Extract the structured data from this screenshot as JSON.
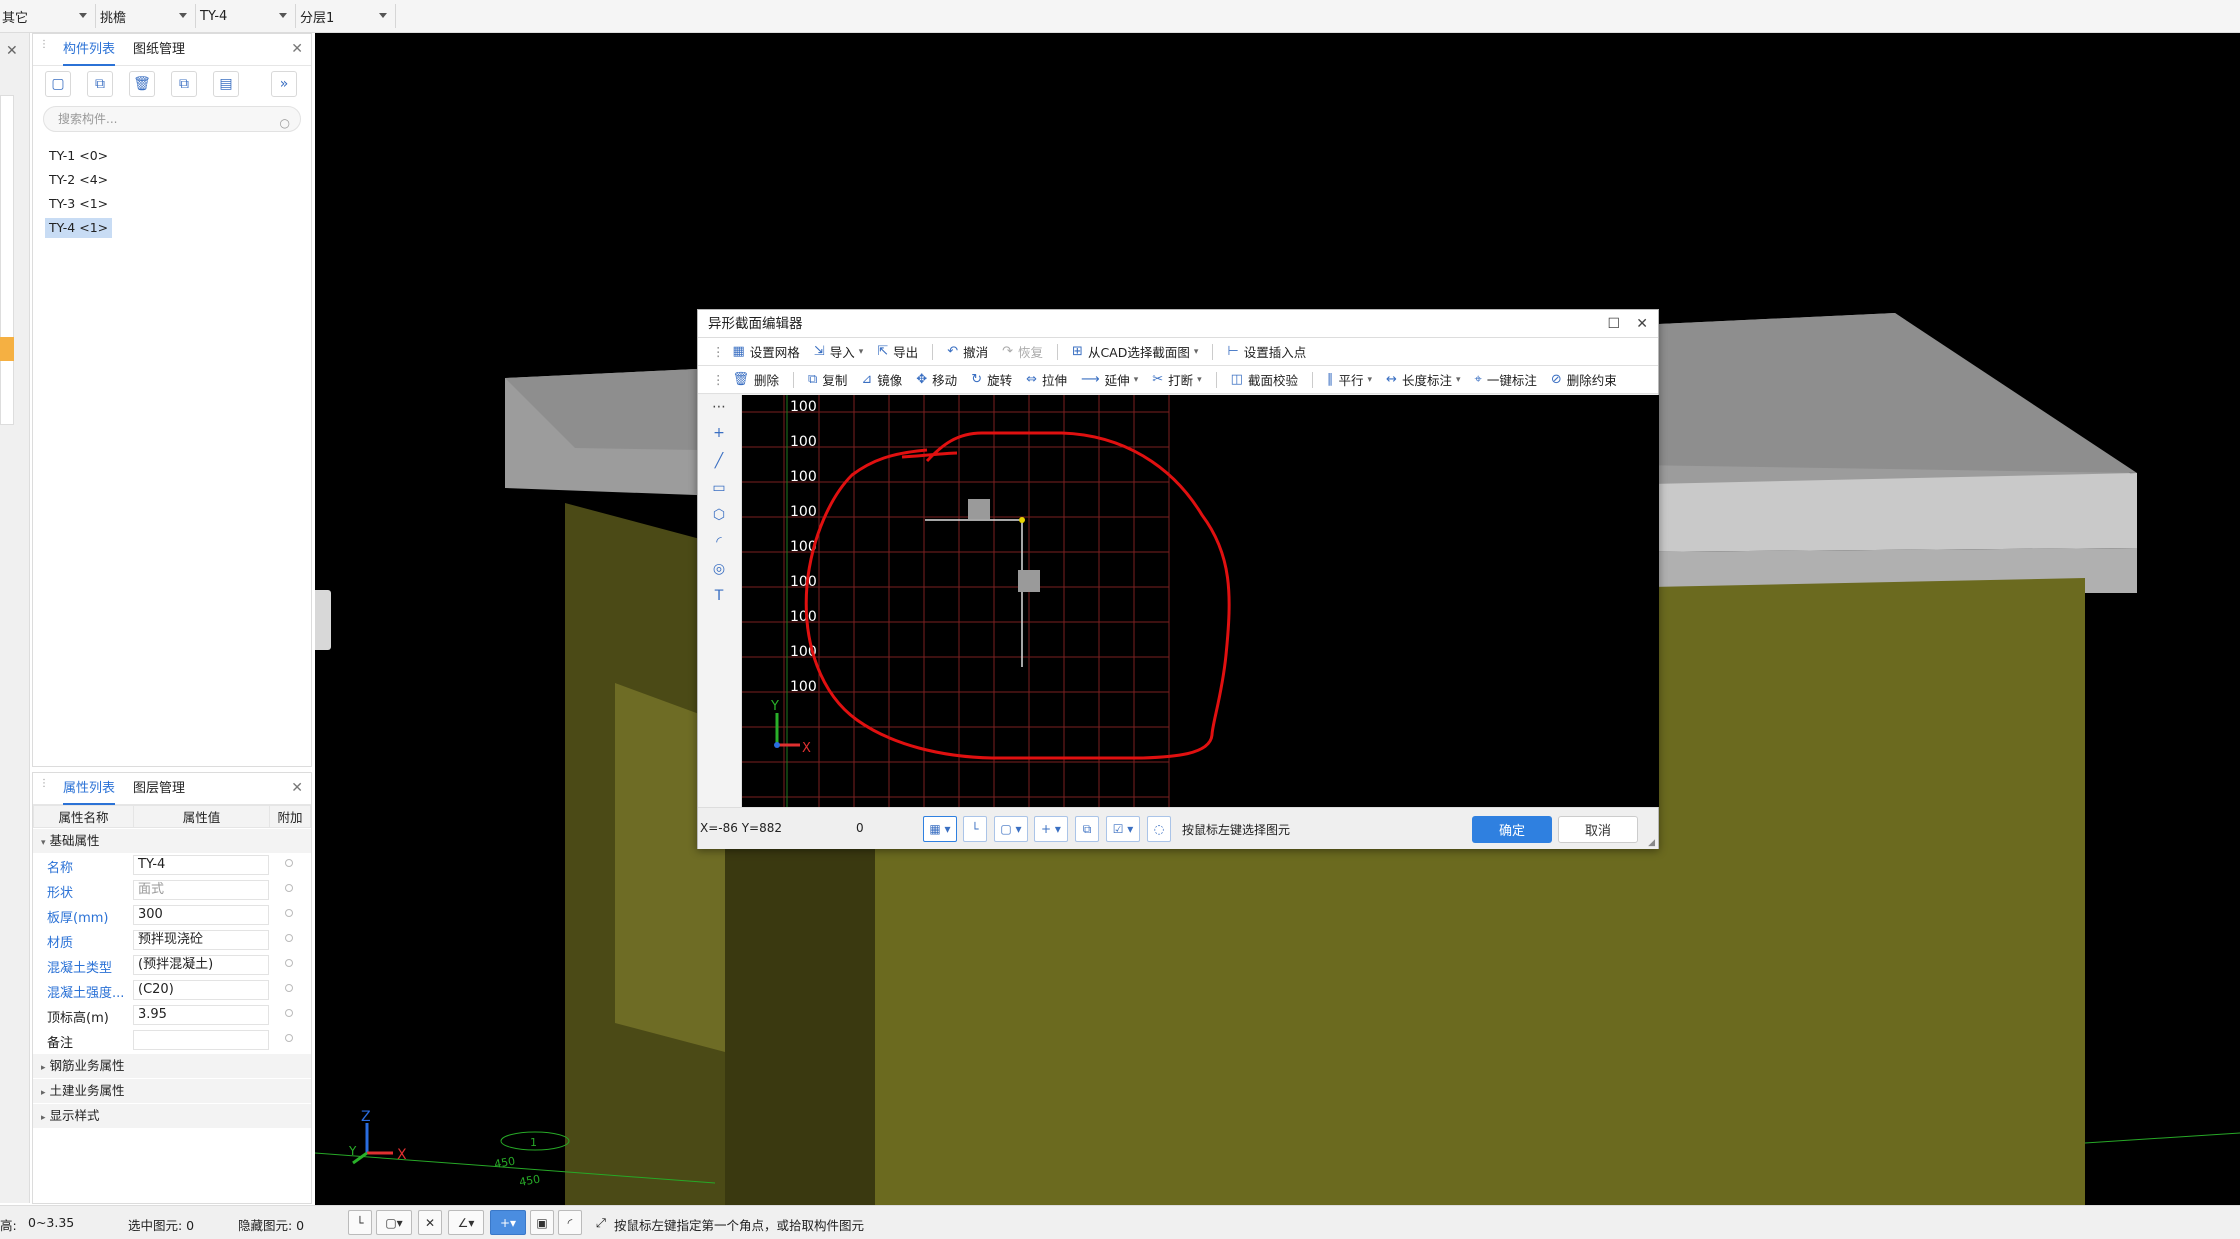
{
  "topbar": {
    "selectors": [
      {
        "label": "其它"
      },
      {
        "label": "挑檐"
      },
      {
        "label": "TY-4"
      },
      {
        "label": "分层1"
      }
    ]
  },
  "component_panel": {
    "tabs": [
      "构件列表",
      "图纸管理"
    ],
    "active_tab": 0,
    "search_placeholder": "搜索构件...",
    "items": [
      "TY-1 <0>",
      "TY-2 <4>",
      "TY-3 <1>",
      "TY-4 <1>"
    ],
    "selected_index": 3
  },
  "property_panel": {
    "tabs": [
      "属性列表",
      "图层管理"
    ],
    "columns": [
      "属性名称",
      "属性值",
      "附加"
    ],
    "group_basic": "基础属性",
    "rows": [
      {
        "name": "名称",
        "value": "TY-4",
        "blue": true,
        "grey": false
      },
      {
        "name": "形状",
        "value": "面式",
        "blue": true,
        "grey": true
      },
      {
        "name": "板厚(mm)",
        "value": "300",
        "blue": true,
        "grey": false
      },
      {
        "name": "材质",
        "value": "预拌现浇砼",
        "blue": true,
        "grey": false
      },
      {
        "name": "混凝土类型",
        "value": "(预拌混凝土)",
        "blue": true,
        "grey": false
      },
      {
        "name": "混凝土强度...",
        "value": "(C20)",
        "blue": true,
        "grey": false
      },
      {
        "name": "顶标高(m)",
        "value": "3.95",
        "blue": false,
        "grey": false
      },
      {
        "name": "备注",
        "value": "",
        "blue": false,
        "grey": false
      }
    ],
    "groups": [
      "钢筋业务属性",
      "土建业务属性",
      "显示样式"
    ]
  },
  "dialog": {
    "title": "异形截面编辑器",
    "toolbar1": [
      {
        "label": "设置网格",
        "icon": "grid-icon"
      },
      {
        "label": "导入",
        "icon": "import-icon"
      },
      {
        "label": "导出",
        "icon": "export-icon"
      },
      {
        "label": "撤消",
        "icon": "undo-icon"
      },
      {
        "label": "恢复",
        "icon": "redo-icon"
      },
      {
        "label": "从CAD选择截面图",
        "icon": "cad-icon"
      },
      {
        "label": "设置插入点",
        "icon": "insert-point-icon"
      }
    ],
    "toolbar2": [
      {
        "label": "删除",
        "icon": "delete-icon"
      },
      {
        "label": "复制",
        "icon": "copy-icon"
      },
      {
        "label": "镜像",
        "icon": "mirror-icon"
      },
      {
        "label": "移动",
        "icon": "move-icon"
      },
      {
        "label": "旋转",
        "icon": "rotate-icon"
      },
      {
        "label": "拉伸",
        "icon": "stretch-icon"
      },
      {
        "label": "延伸",
        "icon": "extend-icon"
      },
      {
        "label": "打断",
        "icon": "break-icon"
      },
      {
        "label": "截面校验",
        "icon": "verify-icon"
      },
      {
        "label": "平行",
        "icon": "parallel-icon"
      },
      {
        "label": "长度标注",
        "icon": "dimension-icon"
      },
      {
        "label": "一键标注",
        "icon": "auto-dimension-icon"
      },
      {
        "label": "删除约束",
        "icon": "remove-constraint-icon"
      }
    ],
    "grid_labels": [
      "100",
      "100",
      "100",
      "100",
      "100",
      "100",
      "100",
      "100",
      "100"
    ],
    "coord": "X=-86 Y=882",
    "value_readout": "0",
    "hint": "按鼠标左键选择图元",
    "ok_label": "确定",
    "cancel_label": "取消",
    "axis_x": "X",
    "axis_y": "Y"
  },
  "viewport": {
    "axis_x": "X",
    "axis_y": "Y",
    "axis_z": "Z",
    "dim_labels": [
      "450",
      "450",
      "1"
    ]
  },
  "statusbar": {
    "height_label": "高:",
    "height_value": "0~3.35",
    "selected_label": "选中图元: 0",
    "hidden_label": "隐藏图元: 0",
    "hint": "按鼠标左键指定第一个角点，或拾取构件图元"
  },
  "colors": {
    "accent": "#2b72d6",
    "ok_button": "#2f80e0",
    "wall": "#6b6a1f",
    "roof": "#9a9a9a",
    "red_annotation": "#e01010",
    "grid": "#7a2020"
  }
}
